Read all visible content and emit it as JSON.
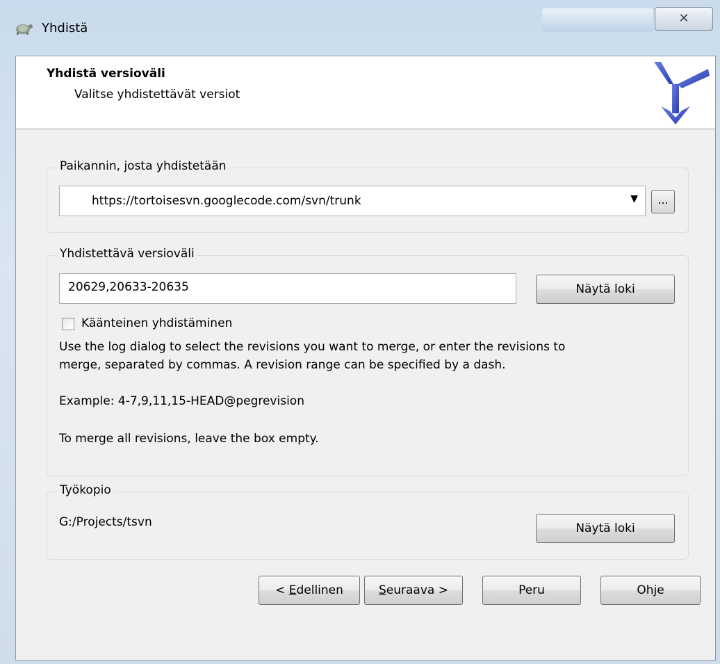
{
  "window": {
    "title": "Yhdistä",
    "close_label": "✕"
  },
  "header": {
    "title": "Yhdistä versioväli",
    "subtitle": "Valitse yhdistettävät versiot"
  },
  "url_group": {
    "label": "Paikannin, josta yhdistetään",
    "url_value": "https://tortoisesvn.googlecode.com/svn/trunk",
    "browse_label": "..."
  },
  "revision_group": {
    "label": "Yhdistettävä versioväli",
    "revisions_value": "20629,20633-20635",
    "show_log_label": "Näytä loki",
    "reverse_merge_label": "Käänteinen yhdistäminen",
    "reverse_merge_checked": false,
    "help_line1": "Use the log dialog to select the revisions you want to merge, or enter the revisions to",
    "help_line2": "merge, separated by commas. A revision range can be specified by a dash.",
    "example": "Example: 4-7,9,11,15-HEAD@pegrevision",
    "empty_hint": "To merge all revisions, leave the box empty."
  },
  "working_copy_group": {
    "label": "Työkopio",
    "path": "G:/Projects/tsvn",
    "show_log_label": "Näytä loki"
  },
  "footer": {
    "back_prefix": "< ",
    "back_key": "E",
    "back_rest": "dellinen",
    "next_key": "S",
    "next_rest": "euraava >",
    "cancel_label": "Peru",
    "help_label": "Ohje"
  }
}
